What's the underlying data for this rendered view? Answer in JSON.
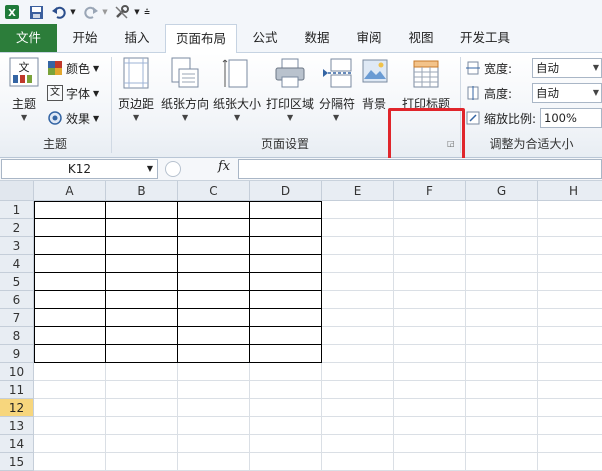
{
  "qat": {
    "excel_icon": "excel-logo-icon",
    "save_icon": "save-icon",
    "undo_icon": "undo-icon",
    "redo_icon": "redo-icon",
    "tools_icon": "wrench-icon"
  },
  "tabs": [
    {
      "label": "文件",
      "key": "file"
    },
    {
      "label": "开始",
      "key": "home"
    },
    {
      "label": "插入",
      "key": "insert"
    },
    {
      "label": "页面布局",
      "key": "layout"
    },
    {
      "label": "公式",
      "key": "formulas"
    },
    {
      "label": "数据",
      "key": "data"
    },
    {
      "label": "审阅",
      "key": "review"
    },
    {
      "label": "视图",
      "key": "view"
    },
    {
      "label": "开发工具",
      "key": "developer"
    }
  ],
  "ribbon": {
    "theme_group": {
      "themes": "主题",
      "colors": "颜色",
      "fonts": "字体",
      "effects": "效果",
      "group_label": "主题",
      "fonts_glyph": "文"
    },
    "page_setup": {
      "margins": "页边距",
      "orientation": "纸张方向",
      "size": "纸张大小",
      "print_area": "打印区域",
      "breaks": "分隔符",
      "background": "背景",
      "print_titles": "打印标题",
      "group_label": "页面设置"
    },
    "scale": {
      "width_label": "宽度:",
      "width_value": "自动",
      "height_label": "高度:",
      "height_value": "自动",
      "zoom_label": "缩放比例:",
      "zoom_value": "100%",
      "group_label": "调整为合适大小"
    }
  },
  "formula_bar": {
    "name_box": "K12",
    "fx": "fx",
    "formula": ""
  },
  "sheet": {
    "columns": [
      "A",
      "B",
      "C",
      "D",
      "E",
      "F",
      "G",
      "H"
    ],
    "rows": [
      "1",
      "2",
      "3",
      "4",
      "5",
      "6",
      "7",
      "8",
      "9",
      "10",
      "11",
      "12",
      "13",
      "14",
      "15"
    ],
    "selected_row": "12"
  },
  "colors": {
    "file_tab": "#2c7d3a",
    "highlight": "#e0252b",
    "selected_header": "#f7d67d"
  }
}
